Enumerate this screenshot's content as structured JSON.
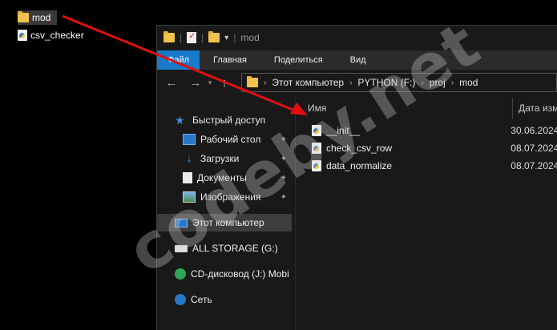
{
  "desktop": {
    "items": [
      {
        "label": "mod",
        "kind": "folder"
      },
      {
        "label": "csv_checker",
        "kind": "python-file"
      }
    ]
  },
  "window": {
    "title": "mod",
    "ribbon": [
      "Файл",
      "Главная",
      "Поделиться",
      "Вид"
    ],
    "breadcrumbs": [
      "Этот компьютер",
      "PYTHON (F:)",
      "proj",
      "mod"
    ]
  },
  "navpane": {
    "quick_access": "Быстрый доступ",
    "pinned": [
      "Рабочий стол",
      "Загрузки",
      "Документы",
      "Изображения"
    ],
    "this_pc": "Этот компьютер",
    "drives": [
      "ALL STORAGE (G:)",
      "CD-дисковод (J:) Mobi"
    ],
    "network": "Сеть"
  },
  "filelist": {
    "columns": {
      "name": "Имя",
      "date": "Дата изме"
    },
    "rows": [
      {
        "name": "__init__",
        "date": "30.06.2024"
      },
      {
        "name": "check_csv_row",
        "date": "08.07.2024"
      },
      {
        "name": "data_normalize",
        "date": "08.07.2024"
      }
    ]
  },
  "watermark": "codeby.net",
  "colors": {
    "ribbon_file_tab": "#1979ca",
    "annotation_arrow": "#e01010",
    "window_bg": "#191919"
  }
}
